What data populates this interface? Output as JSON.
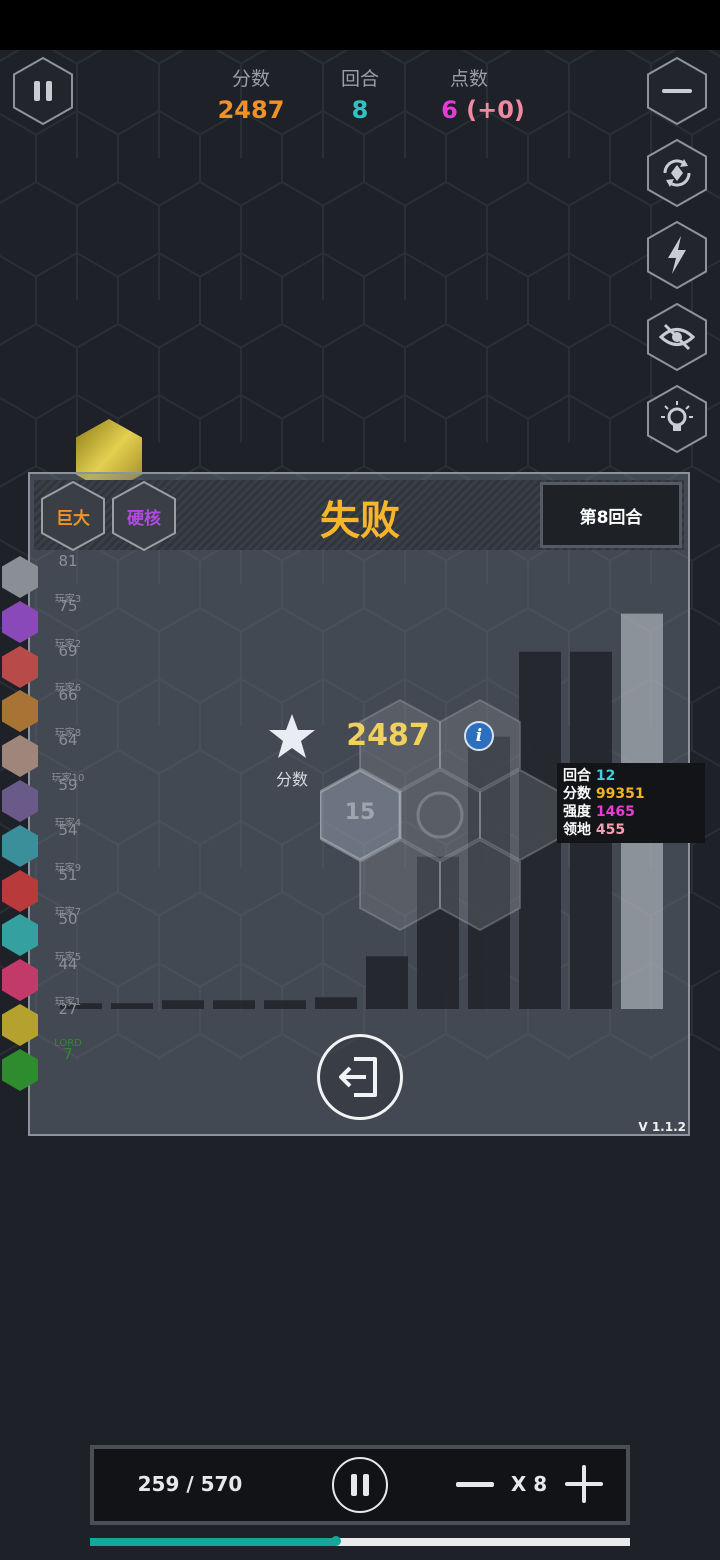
{
  "header": {
    "score": {
      "label": "分数",
      "value": "2487"
    },
    "round": {
      "label": "回合",
      "value": "8"
    },
    "points": {
      "label": "点数",
      "value": "6 (+0)"
    }
  },
  "side_buttons": [
    {
      "name": "minus-icon"
    },
    {
      "name": "refresh-icon"
    },
    {
      "name": "lightning-icon"
    },
    {
      "name": "eye-off-icon"
    },
    {
      "name": "lightbulb-icon"
    }
  ],
  "panel": {
    "badge_giant": "巨大",
    "badge_hardcore": "硬核",
    "title": "失败",
    "round_label": "第8回合",
    "center_hex_number": "15",
    "result_score": "2487",
    "result_score_label": "分数",
    "version": "V 1.1.2"
  },
  "leaderboard": [
    {
      "name": "",
      "score": "81",
      "color": "#8a8f96"
    },
    {
      "name": "玩家3",
      "score": "75",
      "color": "#8a49b8"
    },
    {
      "name": "玩家2",
      "score": "69",
      "color": "#b84a4a"
    },
    {
      "name": "玩家6",
      "score": "66",
      "color": "#a87436"
    },
    {
      "name": "玩家8",
      "score": "64",
      "color": "#a0867a"
    },
    {
      "name": "玩家10",
      "score": "59",
      "color": "#6a5a8a"
    },
    {
      "name": "玩家4",
      "score": "54",
      "color": "#3b8f9a"
    },
    {
      "name": "玩家9",
      "score": "51",
      "color": "#b83a3a"
    },
    {
      "name": "玩家7",
      "score": "50",
      "color": "#35a0a0"
    },
    {
      "name": "玩家5",
      "score": "44",
      "color": "#c23a6a"
    },
    {
      "name": "玩家1",
      "score": "27",
      "color": "#b5a22e"
    },
    {
      "name": "LORD",
      "score": "7",
      "color": "#2e8b2e"
    }
  ],
  "tooltip": {
    "round": {
      "label": "回合",
      "value": "12"
    },
    "score": {
      "label": "分数",
      "value": "99351"
    },
    "strength": {
      "label": "强度",
      "value": "1465"
    },
    "territory": {
      "label": "领地",
      "value": "455"
    }
  },
  "colors": {
    "score": "#f0922a",
    "round": "#2ec4c4",
    "points": "#e63ad6",
    "tip_round": "#3fd0e0",
    "tip_score": "#f5b324",
    "tip_strength": "#f03ad6",
    "tip_territory": "#f2a0b0"
  },
  "chart_data": {
    "type": "bar",
    "values": [
      2,
      2,
      3,
      3,
      3,
      4,
      18,
      52,
      93,
      122,
      122,
      135
    ],
    "ylim": [
      0,
      140
    ]
  },
  "playback": {
    "counter": "259 / 570",
    "speed": "X 8",
    "progress": 0.455
  }
}
